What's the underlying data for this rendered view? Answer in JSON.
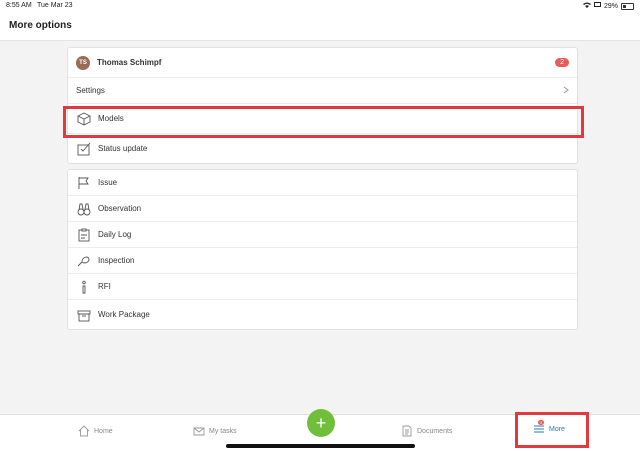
{
  "status_bar": {
    "time": "8:55 AM",
    "date": "Tue Mar 23",
    "battery": "29%"
  },
  "header": {
    "title": "More options"
  },
  "profile": {
    "initials": "TS",
    "name": "Thomas Schimpf",
    "badge": "2"
  },
  "settings": {
    "label": "Settings"
  },
  "section1": [
    {
      "label": "Models",
      "icon": "cube-icon"
    },
    {
      "label": "Status update",
      "icon": "status-update-icon"
    }
  ],
  "section2": [
    {
      "label": "Issue",
      "icon": "flag-icon"
    },
    {
      "label": "Observation",
      "icon": "binoculars-icon"
    },
    {
      "label": "Daily Log",
      "icon": "clipboard-icon"
    },
    {
      "label": "Inspection",
      "icon": "inspection-icon"
    },
    {
      "label": "RFI",
      "icon": "info-icon"
    },
    {
      "label": "Work Package",
      "icon": "box-icon"
    }
  ],
  "tabbar": {
    "home": "Home",
    "my_tasks": "My tasks",
    "documents": "Documents",
    "more": "More",
    "more_badge": "2",
    "add": "+"
  },
  "colors": {
    "accent_green": "#6fbf3a",
    "highlight_red": "#e0393e",
    "badge_red": "#e85c5c",
    "active_blue": "#2a7ab8"
  }
}
